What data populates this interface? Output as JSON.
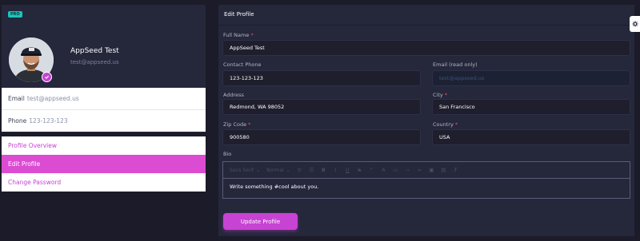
{
  "profile": {
    "badge": "PRO",
    "name": "AppSeed Test",
    "email": "test@appseed.us",
    "avatar_icon": "user-avatar",
    "verified_icon": "check-icon"
  },
  "contact": {
    "email_label": "Email",
    "email_value": "test@appseed.us",
    "phone_label": "Phone",
    "phone_value": "123-123-123"
  },
  "nav": {
    "items": [
      {
        "label": "Profile Overview",
        "active": false
      },
      {
        "label": "Edit Profile",
        "active": true
      },
      {
        "label": "Change Password",
        "active": false
      }
    ]
  },
  "form": {
    "title": "Edit Profile",
    "full_name": {
      "label": "Full Name",
      "value": "AppSeed Test"
    },
    "contact_phone": {
      "label": "Contact Phone",
      "value": "123-123-123"
    },
    "email": {
      "label": "Email (read only)",
      "placeholder": "test@appseed.us"
    },
    "address": {
      "label": "Address",
      "value": "Redmond, WA 98052"
    },
    "city": {
      "label": "City",
      "value": "San Francisco"
    },
    "zip": {
      "label": "Zip Code",
      "value": "900580"
    },
    "country": {
      "label": "Country",
      "value": "USA"
    },
    "bio": {
      "label": "Bio",
      "font_select": "Sans Serif",
      "size_select": "Normal",
      "text": "Write something #cool about you."
    },
    "submit_label": "Update Profile"
  },
  "colors": {
    "accent": "#c743d3",
    "panel": "#25273b",
    "background": "#1b1b29",
    "pro_badge": "#1bc5bd",
    "required": "#f64e60"
  }
}
